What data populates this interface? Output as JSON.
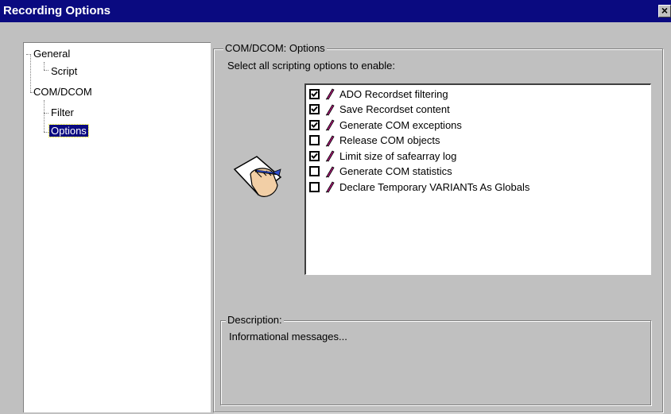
{
  "window": {
    "title": "Recording Options",
    "close_label": "×"
  },
  "tree": {
    "items": [
      {
        "label": "General"
      },
      {
        "label": "Script"
      },
      {
        "label": "COM/DCOM"
      },
      {
        "label": "Filter"
      },
      {
        "label": "Options",
        "selected": true
      }
    ]
  },
  "options_group": {
    "title": "COM/DCOM: Options",
    "instruction": "Select all scripting options to enable:"
  },
  "options": [
    {
      "label": "ADO Recordset filtering",
      "checked": true
    },
    {
      "label": "Save Recordset content",
      "checked": true
    },
    {
      "label": "Generate COM exceptions",
      "checked": true
    },
    {
      "label": "Release COM objects",
      "checked": false
    },
    {
      "label": "Limit size of safearray log",
      "checked": true
    },
    {
      "label": "Generate COM statistics",
      "checked": false
    },
    {
      "label": "Declare Temporary VARIANTs As Globals",
      "checked": false
    }
  ],
  "description": {
    "title": "Description:",
    "text": "Informational messages..."
  },
  "icons": {
    "option_icon": "pencil-icon",
    "illustration": "hand-writing-on-paper-icon"
  },
  "colors": {
    "titlebar": "#0a0a80",
    "pencil": "#b0187a",
    "face": "#c0c0c0"
  }
}
